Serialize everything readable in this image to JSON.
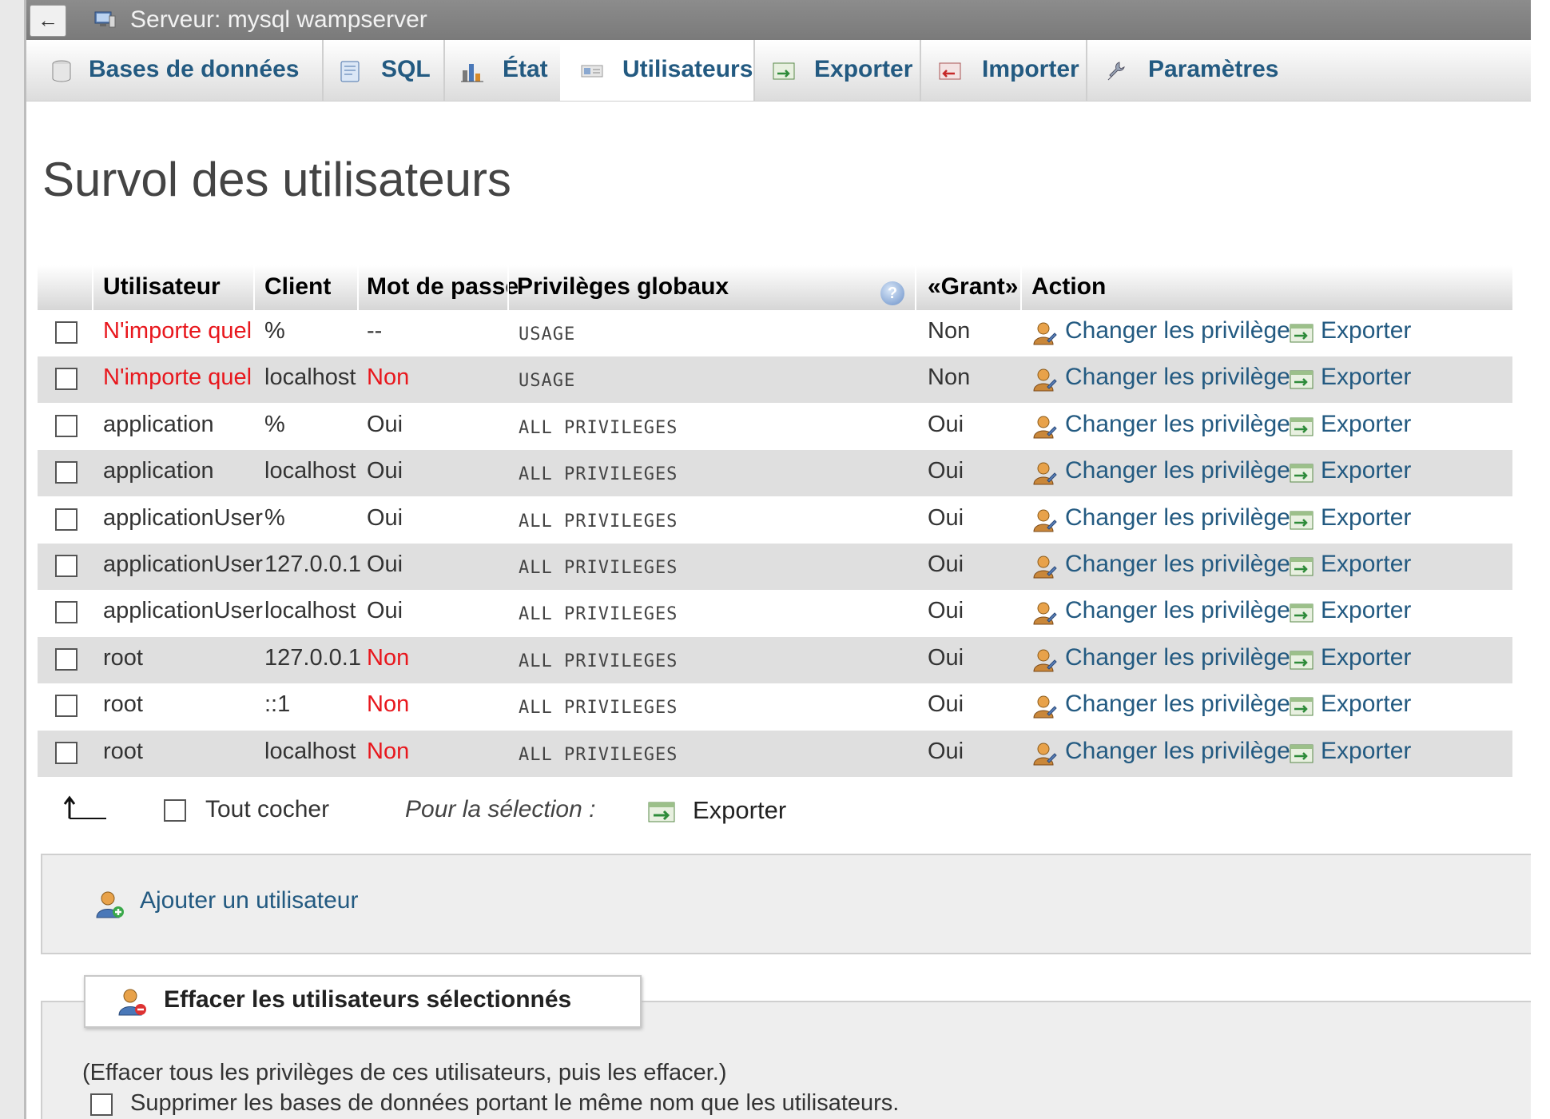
{
  "server_bar": {
    "back": "←",
    "title": "Serveur: mysql wampserver"
  },
  "tabs": [
    {
      "label": "Bases de données",
      "icon": "database-icon"
    },
    {
      "label": "SQL",
      "icon": "sql-icon"
    },
    {
      "label": "État",
      "icon": "status-chart-icon"
    },
    {
      "label": "Utilisateurs",
      "icon": "users-icon",
      "active": true
    },
    {
      "label": "Exporter",
      "icon": "export-icon"
    },
    {
      "label": "Importer",
      "icon": "import-icon"
    },
    {
      "label": "Paramètres",
      "icon": "wrench-icon"
    }
  ],
  "page_title": "Survol des utilisateurs",
  "table": {
    "headers": [
      "Utilisateur",
      "Client",
      "Mot de passe",
      "Privilèges globaux",
      "«Grant»",
      "Action"
    ],
    "help_icon": "?",
    "action_change": "Changer les privilèges",
    "action_export": "Exporter",
    "rows": [
      {
        "user": "N'importe quel",
        "user_red": true,
        "host": "%",
        "password": "--",
        "password_red": false,
        "privileges": "USAGE",
        "grant": "Non"
      },
      {
        "user": "N'importe quel",
        "user_red": true,
        "host": "localhost",
        "password": "Non",
        "password_red": true,
        "privileges": "USAGE",
        "grant": "Non"
      },
      {
        "user": "application",
        "user_red": false,
        "host": "%",
        "password": "Oui",
        "password_red": false,
        "privileges": "ALL PRIVILEGES",
        "grant": "Oui"
      },
      {
        "user": "application",
        "user_red": false,
        "host": "localhost",
        "password": "Oui",
        "password_red": false,
        "privileges": "ALL PRIVILEGES",
        "grant": "Oui"
      },
      {
        "user": "applicationUser",
        "user_red": false,
        "host": "%",
        "password": "Oui",
        "password_red": false,
        "privileges": "ALL PRIVILEGES",
        "grant": "Oui"
      },
      {
        "user": "applicationUser",
        "user_red": false,
        "host": "127.0.0.1",
        "password": "Oui",
        "password_red": false,
        "privileges": "ALL PRIVILEGES",
        "grant": "Oui"
      },
      {
        "user": "applicationUser",
        "user_red": false,
        "host": "localhost",
        "password": "Oui",
        "password_red": false,
        "privileges": "ALL PRIVILEGES",
        "grant": "Oui"
      },
      {
        "user": "root",
        "user_red": false,
        "host": "127.0.0.1",
        "password": "Non",
        "password_red": true,
        "privileges": "ALL PRIVILEGES",
        "grant": "Oui"
      },
      {
        "user": "root",
        "user_red": false,
        "host": "::1",
        "password": "Non",
        "password_red": true,
        "privileges": "ALL PRIVILEGES",
        "grant": "Oui"
      },
      {
        "user": "root",
        "user_red": false,
        "host": "localhost",
        "password": "Non",
        "password_red": true,
        "privileges": "ALL PRIVILEGES",
        "grant": "Oui"
      }
    ]
  },
  "selection": {
    "check_all": "Tout cocher",
    "for_selection": "Pour la sélection :",
    "export": "Exporter"
  },
  "add_user": {
    "label": "Ajouter un utilisateur"
  },
  "delete_section": {
    "legend": "Effacer les utilisateurs sélectionnés",
    "note": "(Effacer tous les privilèges de ces utilisateurs, puis les effacer.)",
    "drop_db_label": "Supprimer les bases de données portant le même nom que les utilisateurs."
  },
  "colors": {
    "link": "#235a81",
    "error_red": "#e8171d",
    "row_alt": "#dfdfdf",
    "server_bar": "#808080"
  }
}
